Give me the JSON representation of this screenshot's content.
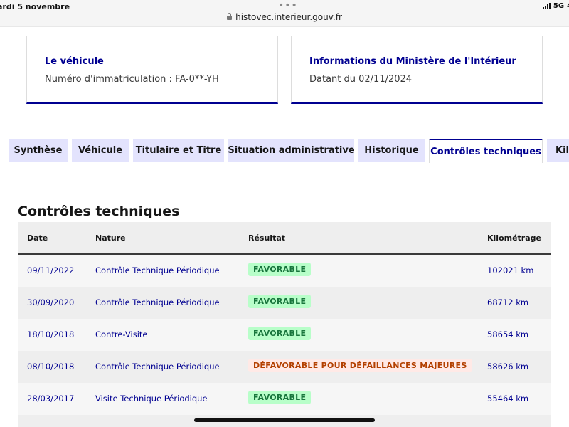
{
  "status_bar": {
    "date": "ardi 5 novembre",
    "dots": "•••",
    "url": "histovec.interieur.gouv.fr",
    "network": "5G",
    "battery": "4"
  },
  "cards": [
    {
      "title": "Le véhicule",
      "text": "Numéro d'immatriculation : FA-0**-YH"
    },
    {
      "title": "Informations du Ministère de l'Intérieur",
      "text": "Datant du 02/11/2024"
    }
  ],
  "tabs": [
    {
      "label": "Synthèse",
      "active": false
    },
    {
      "label": "Véhicule",
      "active": false
    },
    {
      "label": "Titulaire et Titre",
      "active": false
    },
    {
      "label": "Situation administrative",
      "active": false
    },
    {
      "label": "Historique",
      "active": false
    },
    {
      "label": "Contrôles techniques",
      "active": true
    },
    {
      "label": "Kil",
      "active": false
    }
  ],
  "section": {
    "title": "Contrôles techniques",
    "columns": {
      "date": "Date",
      "nature": "Nature",
      "result": "Résultat",
      "km": "Kilométrage"
    },
    "rows": [
      {
        "date": "09/11/2022",
        "nature": "Contrôle Technique Périodique",
        "result": "FAVORABLE",
        "status": "ok",
        "km": "102021 km"
      },
      {
        "date": "30/09/2020",
        "nature": "Contrôle Technique Périodique",
        "result": "FAVORABLE",
        "status": "ok",
        "km": "68712 km"
      },
      {
        "date": "18/10/2018",
        "nature": "Contre-Visite",
        "result": "FAVORABLE",
        "status": "ok",
        "km": "58654 km"
      },
      {
        "date": "08/10/2018",
        "nature": "Contrôle Technique Périodique",
        "result": "DÉFAVORABLE POUR DÉFAILLANCES MAJEURES",
        "status": "ko",
        "km": "58626 km"
      },
      {
        "date": "28/03/2017",
        "nature": "Visite Technique Périodique",
        "result": "FAVORABLE",
        "status": "ok",
        "km": "55464 km"
      }
    ]
  },
  "colors": {
    "primary": "#000091",
    "tab_bg": "#e3e3fd",
    "success_bg": "#b8fec9",
    "success_text": "#18753c",
    "error_bg": "#ffe9e6",
    "error_text": "#b34000"
  }
}
